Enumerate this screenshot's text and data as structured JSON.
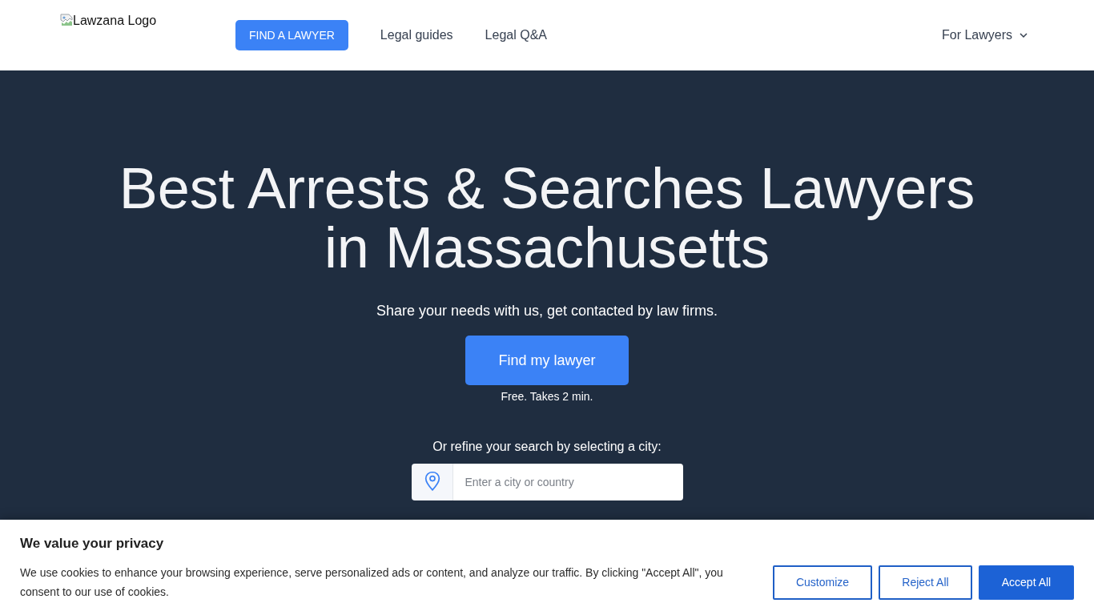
{
  "header": {
    "logo_alt": "Lawzana Logo",
    "nav": [
      {
        "label": "FIND A LAWYER",
        "kind": "button"
      },
      {
        "label": "Legal guides",
        "kind": "link"
      },
      {
        "label": "Legal Q&A",
        "kind": "link"
      }
    ],
    "menu": {
      "label": "For Lawyers"
    }
  },
  "hero": {
    "title": "Best Arrests & Searches Lawyers in Massachusetts",
    "subtitle": "Share your needs with us, get contacted by law firms.",
    "cta_button": "Find my lawyer",
    "cta_note": "Free. Takes 2 min.",
    "refine_label": "Or refine your search by selecting a city:",
    "city_search": {
      "placeholder": "Enter a city or country"
    }
  },
  "cookie_banner": {
    "title": "We value your privacy",
    "text": "We use cookies to enhance your browsing experience, serve personalized ads or content, and analyze our traffic. By clicking \"Accept All\", you consent to our use of cookies.",
    "buttons": [
      {
        "label": "Customize",
        "kind": "outline"
      },
      {
        "label": "Reject All",
        "kind": "outline"
      },
      {
        "label": "Accept All",
        "kind": "primary"
      }
    ]
  }
}
